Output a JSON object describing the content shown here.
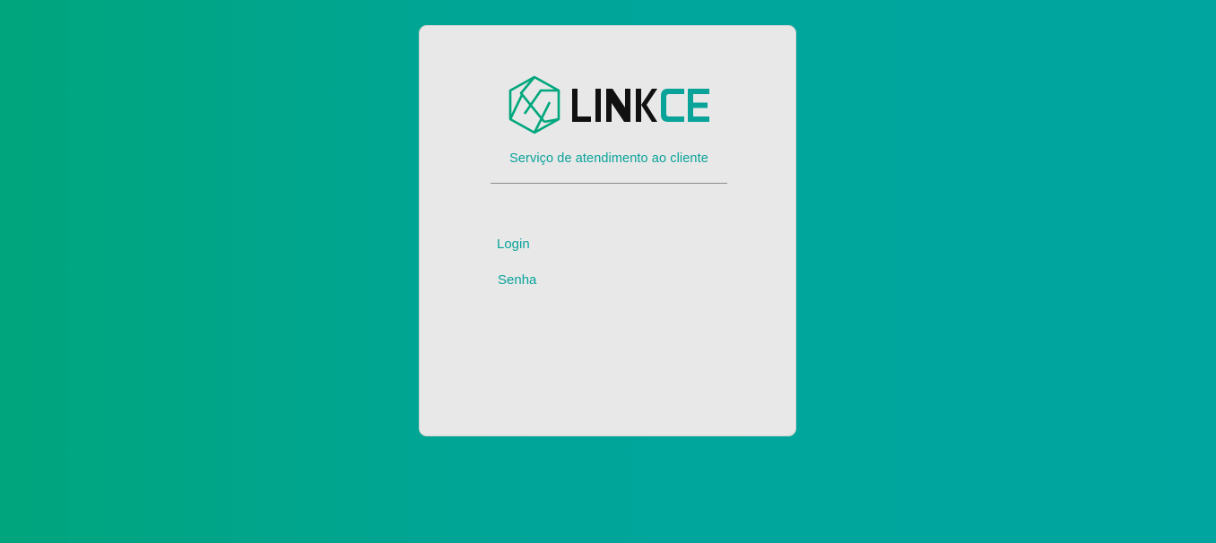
{
  "brand": {
    "logo_text_dark": "LINK",
    "logo_text_accent": "CE",
    "accent_color": "#0aa39a",
    "dark_color": "#111111",
    "icon": "hexagon-shutter-logo-icon"
  },
  "subtitle": "Serviço de atendimento ao cliente",
  "form": {
    "login_label": "Login",
    "login_value": "",
    "password_label": "Senha",
    "password_value": ""
  },
  "colors": {
    "background_start": "#00a57d",
    "background_end": "#00a59f",
    "card": "#e8e8e8"
  }
}
